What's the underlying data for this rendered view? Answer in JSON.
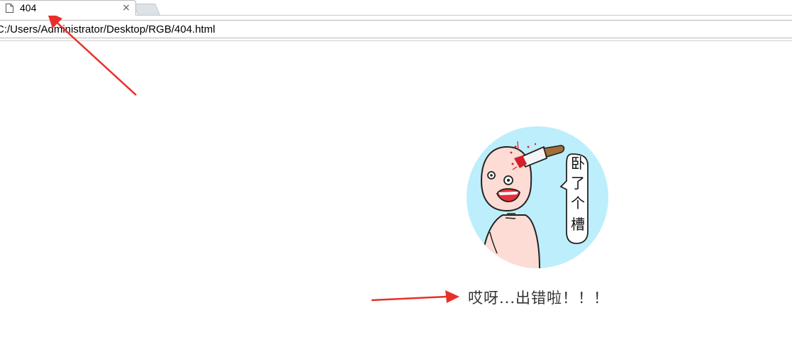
{
  "browser": {
    "tab": {
      "title": "404",
      "icon": "page-icon",
      "close_symbol": "×"
    },
    "address_bar": {
      "url": "C:/Users/Administrator/Desktop/RGB/404.html"
    }
  },
  "page": {
    "illustration": {
      "description_icon": "cartoon-knife-in-head",
      "speech_text": [
        "卧",
        "了",
        "个",
        "槽"
      ],
      "background_color": "#bdeefc"
    },
    "message": "哎呀...出错啦！！！"
  },
  "annotation_color": "#e8302a"
}
